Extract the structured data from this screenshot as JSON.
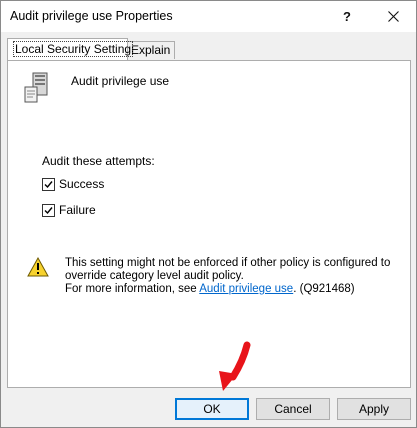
{
  "window": {
    "title": "Audit privilege use Properties",
    "help_label": "?",
    "close_icon": "close-icon"
  },
  "tabs": [
    {
      "label": "Local Security Setting",
      "active": true
    },
    {
      "label": "Explain",
      "active": false
    }
  ],
  "panel": {
    "policy_icon": "server-icon",
    "policy_name": "Audit privilege use",
    "attempts_label": "Audit these attempts:",
    "checkboxes": [
      {
        "label": "Success",
        "checked": true
      },
      {
        "label": "Failure",
        "checked": true
      }
    ],
    "warning": {
      "icon": "warning-icon",
      "line1": "This setting might not be enforced if other policy is configured to",
      "line2": "override category level audit policy.",
      "line3_prefix": "For more information, see ",
      "link_text": "Audit privilege use",
      "line3_suffix": ". (Q921468)"
    }
  },
  "buttons": {
    "ok": "OK",
    "cancel": "Cancel",
    "apply": "Apply"
  },
  "annotation": {
    "icon": "red-arrow-icon",
    "color": "#e8141a"
  },
  "colors": {
    "accent": "#0078d7",
    "link": "#0066cc",
    "dialog_bg": "#f0f0f0"
  }
}
